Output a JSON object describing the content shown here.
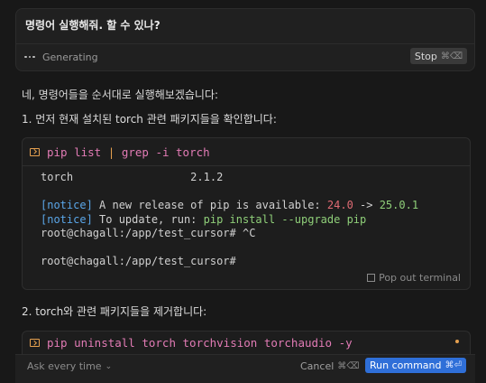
{
  "prompt": {
    "text": "명령어 실행해줘. 할 수 있나?",
    "status": "Generating",
    "stop_label": "Stop",
    "stop_shortcut": "⌘⌫"
  },
  "assistant": {
    "intro": "네, 명령어들을 순서대로 실행해보겠습니다:",
    "step1": "1. 먼저 현재 설치된 torch 관련 패키지들을 확인합니다:",
    "step2": "2. torch와 관련 패키지들을 제거합니다:"
  },
  "terminal1": {
    "cmd": "pip list",
    "pipe": "|",
    "cmd2": "grep -i torch",
    "line1": "torch                  2.1.2",
    "notice_tag": "[notice]",
    "notice1_a": " A new release of pip is available: ",
    "old_version": "24.0",
    "arrow": " -> ",
    "new_version": "25.0.1",
    "notice2_a": " To update, run: ",
    "update_cmd": "pip install --upgrade pip",
    "prompt1": "root@chagall:/app/test_cursor# ^C",
    "prompt2": "root@chagall:/app/test_cursor#",
    "popout_label": "Pop out terminal"
  },
  "terminal2": {
    "cmd": "pip uninstall torch torchvision torchaudio -y"
  },
  "footer": {
    "ask_label": "Ask every time",
    "cancel_label": "Cancel",
    "cancel_shortcut": "⌘⌫",
    "run_label": "Run command",
    "run_shortcut": "⌘⏎"
  },
  "colors": {
    "accent": "#2f6fd8",
    "warning": "#e5a04f",
    "command": "#e27bb5"
  }
}
